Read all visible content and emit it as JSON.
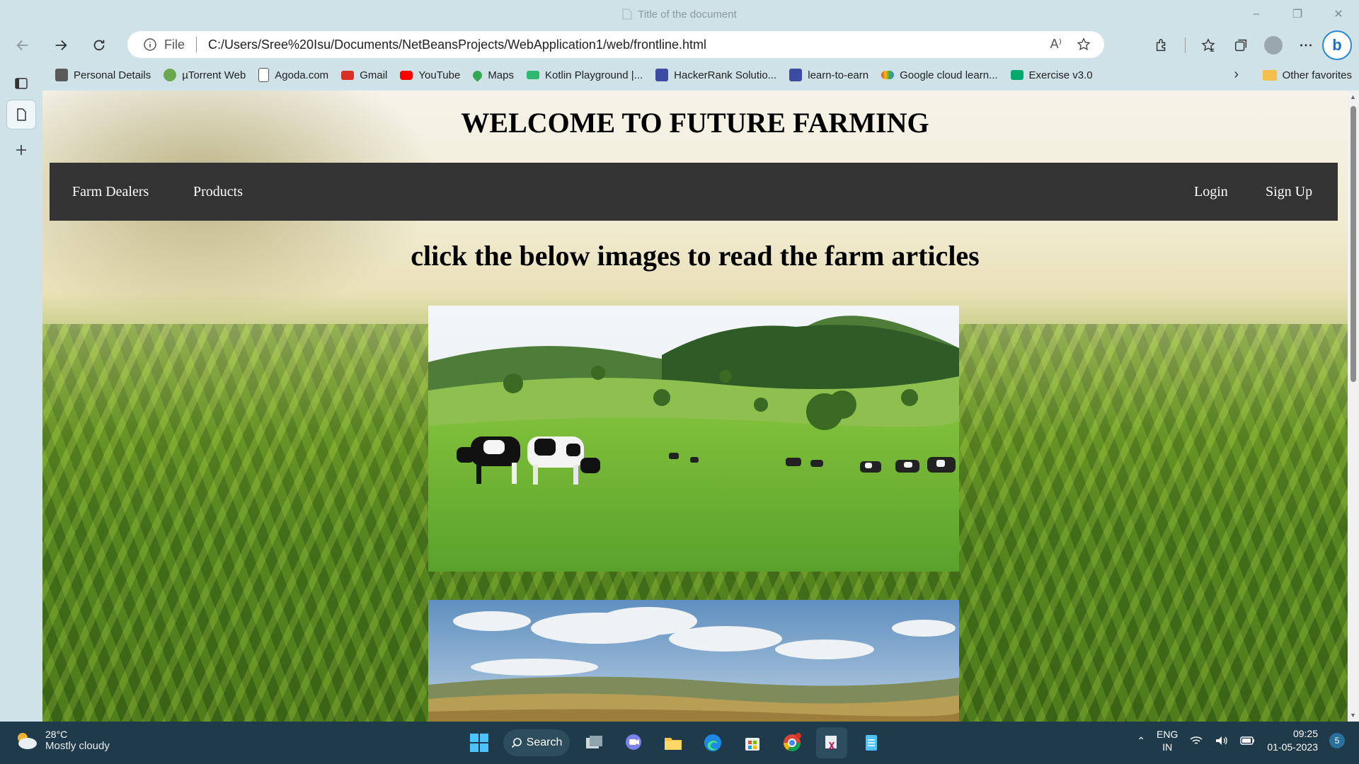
{
  "window": {
    "title": "Title of the document",
    "controls": [
      "minimize",
      "restore",
      "close"
    ]
  },
  "toolbar": {
    "scheme_label": "File",
    "url": "C:/Users/Sree%20Isu/Documents/NetBeansProjects/WebApplication1/web/frontline.html",
    "read_aloud": "A⁾"
  },
  "favorites": {
    "items": [
      {
        "label": "Personal Details",
        "icon": "bookmark-icon",
        "color": "#5a5a5a"
      },
      {
        "label": "µTorrent Web",
        "icon": "utorrent-icon",
        "color": "#6aa84f"
      },
      {
        "label": "Agoda.com",
        "icon": "page-icon",
        "color": "#ffffff"
      },
      {
        "label": "Gmail",
        "icon": "gmail-icon",
        "color": "#d93025"
      },
      {
        "label": "YouTube",
        "icon": "youtube-icon",
        "color": "#ff0000"
      },
      {
        "label": "Maps",
        "icon": "maps-icon",
        "color": "#34a853"
      },
      {
        "label": "Kotlin Playground |...",
        "icon": "kotlin-icon",
        "color": "#2eb872"
      },
      {
        "label": "HackerRank Solutio...",
        "icon": "hackerrank-icon",
        "color": "#3c4ba3"
      },
      {
        "label": "learn-to-earn",
        "icon": "learn-icon",
        "color": "#3c4ba3"
      },
      {
        "label": "Google cloud learn...",
        "icon": "gcloud-icon",
        "color": "#4285f4"
      },
      {
        "label": "Exercise v3.0",
        "icon": "w3-icon",
        "color": "#04aa6d"
      }
    ],
    "other": "Other favorites"
  },
  "page": {
    "heading": "WELCOME TO FUTURE FARMING",
    "nav_left": [
      "Farm Dealers",
      "Products"
    ],
    "nav_right": [
      "Login",
      "Sign Up"
    ],
    "subheading": "click the below images to read the farm articles"
  },
  "taskbar": {
    "temperature": "28°C",
    "weather": "Mostly cloudy",
    "search_label": "Search",
    "lang_top": "ENG",
    "lang_bottom": "IN",
    "time": "09:25",
    "date": "01-05-2023",
    "notifications": "5"
  }
}
